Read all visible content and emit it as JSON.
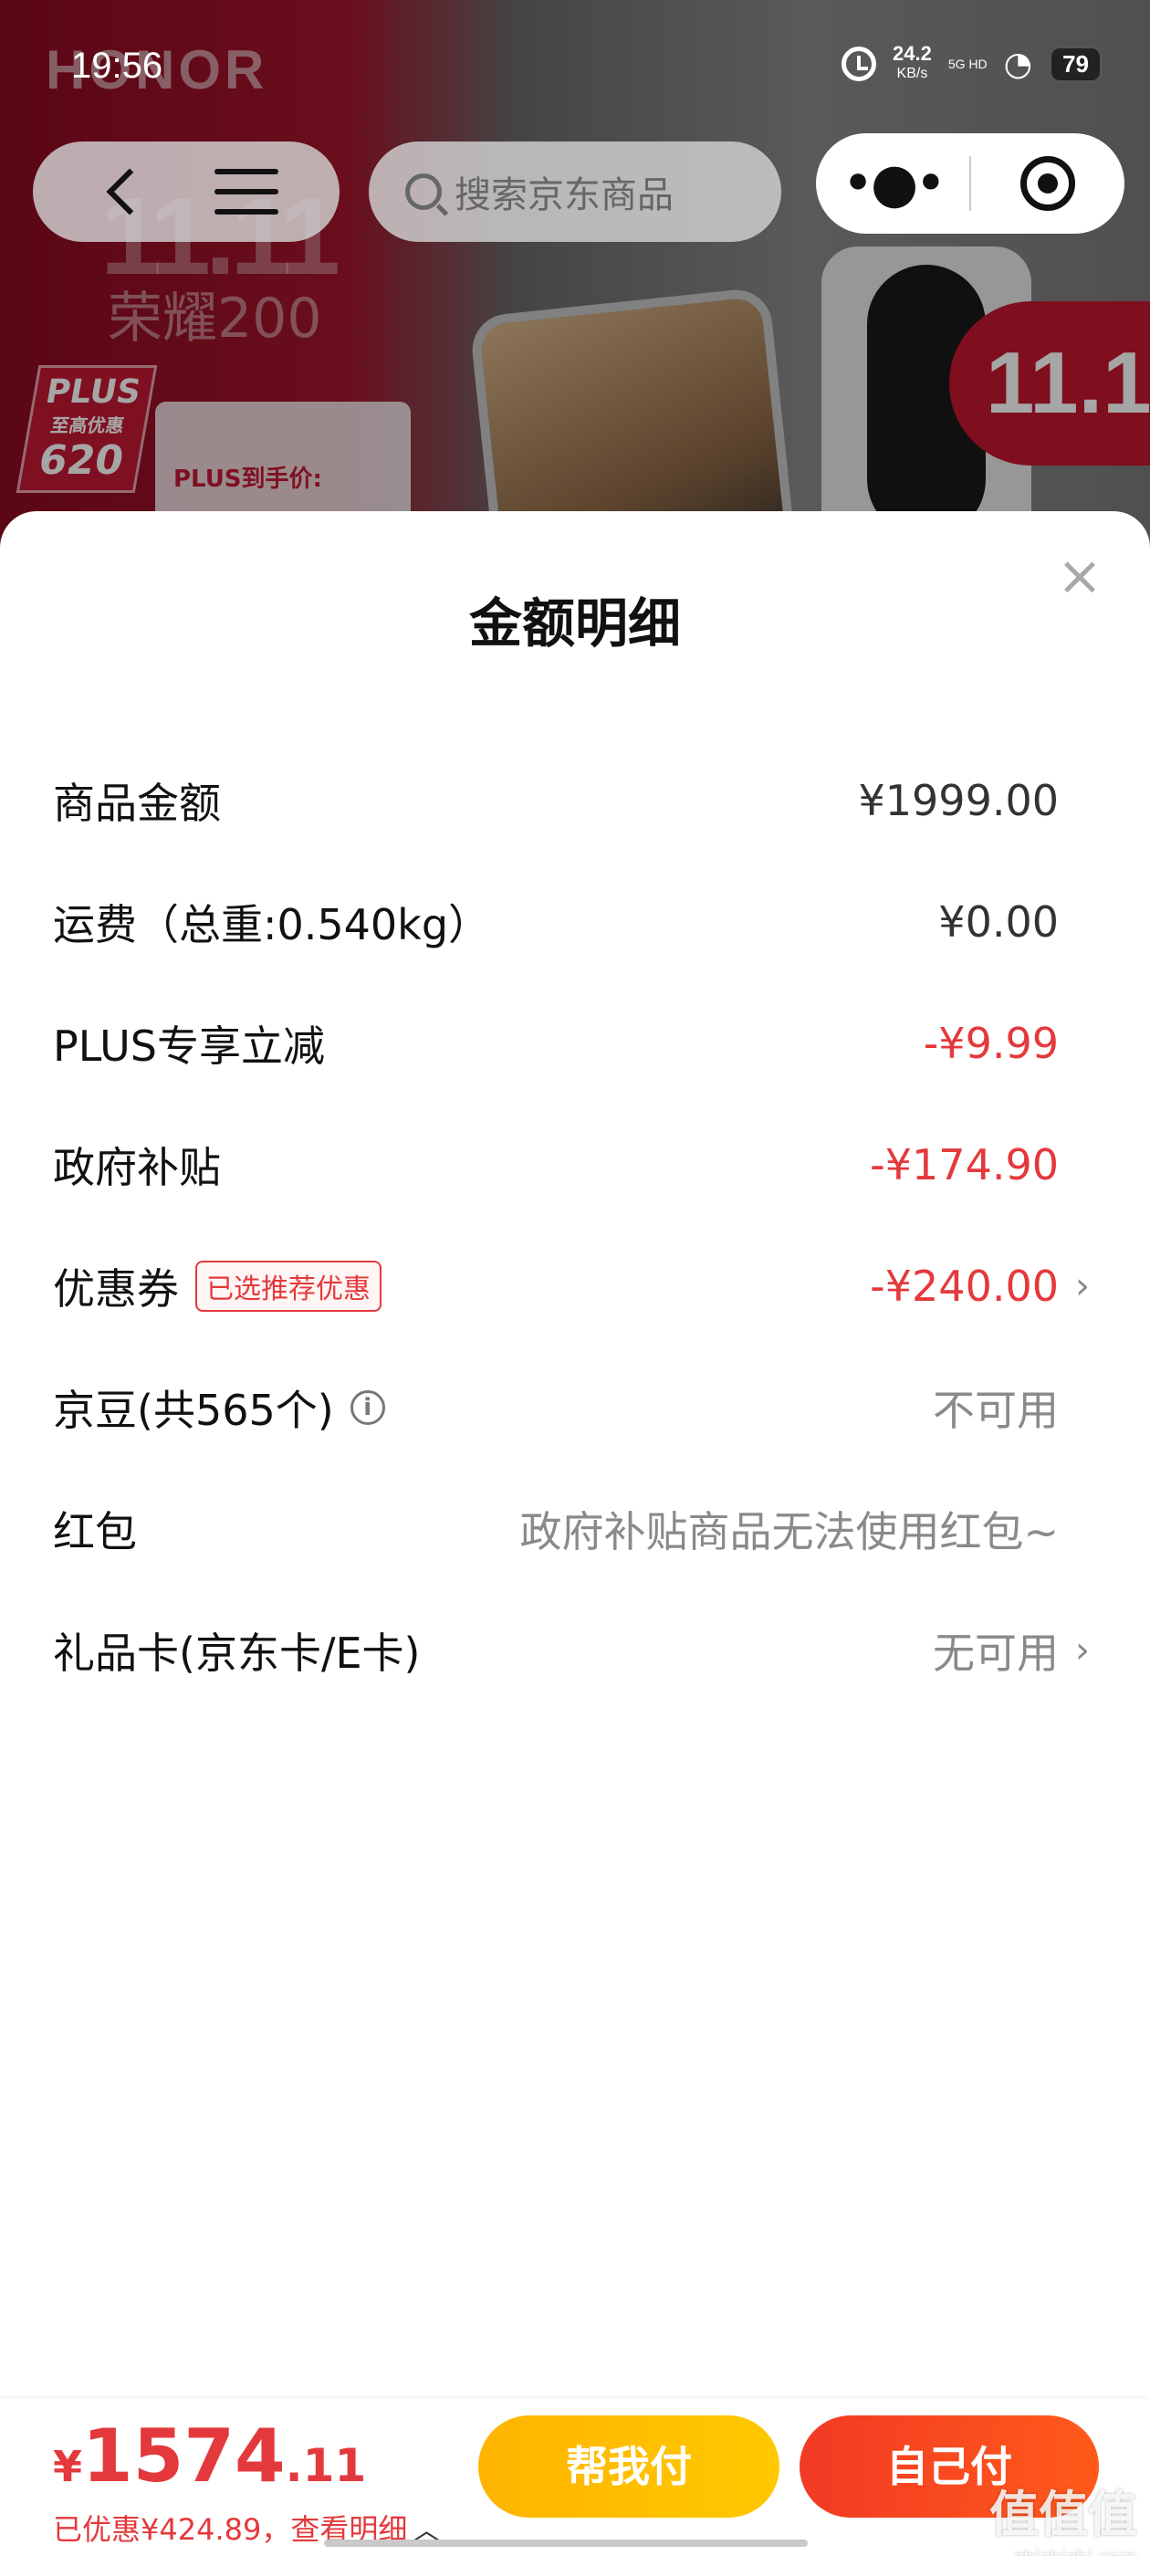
{
  "status_bar": {
    "time": "19:56",
    "speed": "24.2",
    "speed_unit": "KB/s",
    "network": "5G HD",
    "battery": "79"
  },
  "background": {
    "brand": "HONOR",
    "event_logo": "11.11",
    "model": "荣耀200",
    "plus_badge_top": "PLUS",
    "plus_badge_mid": "至高优惠",
    "plus_badge_amount": "620",
    "plus_price_label": "PLUS到手价:"
  },
  "nav": {
    "search_placeholder": "搜索京东商品"
  },
  "sheet": {
    "title": "金额明细",
    "close_symbol": "×",
    "rows": [
      {
        "label": "商品金额",
        "value": "¥1999.00"
      },
      {
        "label": "运费（总重:0.540kg）",
        "value": "¥0.00"
      },
      {
        "label": "PLUS专享立减",
        "value": "-¥9.99"
      },
      {
        "label": "政府补贴",
        "value": "-¥174.90"
      },
      {
        "label": "优惠券",
        "tag": "已选推荐优惠",
        "value": "-¥240.00"
      },
      {
        "label": "京豆(共565个)",
        "value": "不可用"
      },
      {
        "label": "红包",
        "value": "政府补贴商品无法使用红包~"
      },
      {
        "label": "礼品卡(京东卡/E卡)",
        "value": "无可用"
      }
    ]
  },
  "footer": {
    "currency": "¥",
    "total_int": "1574",
    "total_dec": ".11",
    "saved_text": "已优惠¥424.89，查看明细",
    "help_pay": "帮我付",
    "self_pay": "自己付"
  },
  "watermark": {
    "main": "值值值",
    "sub": "zhizhizhi.com"
  },
  "colors": {
    "accent_red": "#e4393c",
    "help_btn": "#ffc000",
    "self_btn": "#f43a22"
  }
}
